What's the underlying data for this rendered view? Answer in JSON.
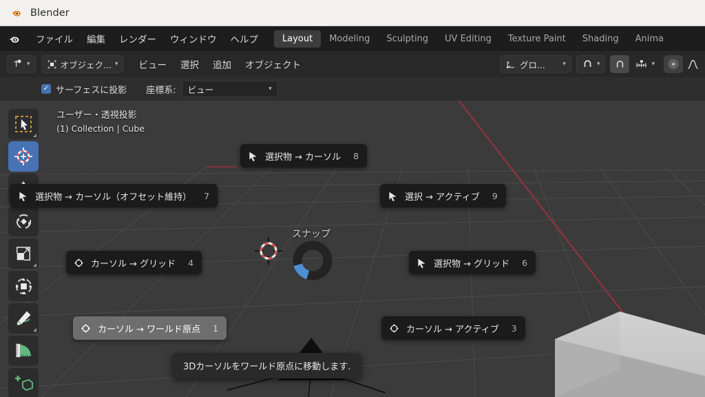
{
  "window": {
    "app_title": "Blender",
    "logo_icon": "blender-logo-icon"
  },
  "topbar": {
    "logo_icon": "blender-logo-icon",
    "menus": [
      "ファイル",
      "編集",
      "レンダー",
      "ウィンドウ",
      "ヘルプ"
    ],
    "tabs": [
      {
        "label": "Layout",
        "active": true
      },
      {
        "label": "Modeling",
        "active": false
      },
      {
        "label": "Sculpting",
        "active": false
      },
      {
        "label": "UV Editing",
        "active": false
      },
      {
        "label": "Texture Paint",
        "active": false
      },
      {
        "label": "Shading",
        "active": false
      },
      {
        "label": "Anima",
        "active": false
      }
    ]
  },
  "tool_header": {
    "editor_type_icon": "editor-type-icon",
    "mode_icon": "object-mode-icon",
    "mode_label": "オブジェク...",
    "menus": [
      "ビュー",
      "選択",
      "追加",
      "オブジェクト"
    ],
    "transform_orientation_icon": "orientation-icon",
    "transform_orientation_label": "グロ...",
    "snap_magnet_icon": "magnet-icon",
    "snap_target_icon": "snap-increment-icon",
    "proportional_icon": "proportional-edit-icon",
    "falloff_icon": "falloff-curve-icon"
  },
  "tool_settings": {
    "project_checkbox_label": "サーフェスに投影",
    "project_checked": true,
    "orientation_label": "座標系:",
    "orientation_value": "ビュー"
  },
  "viewport": {
    "view_name": "ユーザー・透視投影",
    "collection_info": "(1) Collection | Cube",
    "background_color": "#3b3b3b",
    "grid_color": "#4f4f4f",
    "x_axis_color": "#a6394b",
    "y_axis_color": "#7aa62a",
    "cube_color": "#c8c8c8",
    "cursor_icon": "3d-cursor-icon"
  },
  "left_toolbar": {
    "tools": [
      {
        "name": "tweak-select-box",
        "icon": "select-box-icon",
        "active": false,
        "has_submenu": true
      },
      {
        "name": "cursor",
        "icon": "3d-cursor-icon",
        "active": true,
        "has_submenu": false
      },
      {
        "name": "move",
        "icon": "move-icon",
        "active": false,
        "has_submenu": false
      },
      {
        "name": "rotate",
        "icon": "rotate-icon",
        "active": false,
        "has_submenu": false
      },
      {
        "name": "scale",
        "icon": "scale-icon",
        "active": false,
        "has_submenu": true
      },
      {
        "name": "transform",
        "icon": "transform-icon",
        "active": false,
        "has_submenu": false
      },
      {
        "name": "annotate",
        "icon": "annotate-pencil-icon",
        "active": false,
        "has_submenu": true
      },
      {
        "name": "measure",
        "icon": "measure-ruler-icon",
        "active": false,
        "has_submenu": false
      },
      {
        "name": "add-cube",
        "icon": "add-cube-icon",
        "active": false,
        "has_submenu": false
      }
    ]
  },
  "pie_menu": {
    "center_label": "スナップ",
    "items": [
      {
        "label": "選択物 → カーソル",
        "key": "8",
        "icon": "cursor-arrow-icon",
        "highlighted": false
      },
      {
        "label": "選択物 → カーソル（オフセット維持）",
        "key": "7",
        "icon": "cursor-arrow-icon",
        "highlighted": false
      },
      {
        "label": "選択 → アクティブ",
        "key": "9",
        "icon": "cursor-arrow-icon",
        "highlighted": false
      },
      {
        "label": "カーソル → グリッド",
        "key": "4",
        "icon": "3d-cursor-icon",
        "highlighted": false
      },
      {
        "label": "選択物 → グリッド",
        "key": "6",
        "icon": "cursor-arrow-icon",
        "highlighted": false
      },
      {
        "label": "カーソル → ワールド原点",
        "key": "1",
        "icon": "3d-cursor-icon",
        "highlighted": true
      },
      {
        "label": "カーソル → アクティブ",
        "key": "3",
        "icon": "3d-cursor-icon",
        "highlighted": false
      }
    ]
  },
  "tooltip": {
    "text": "3Dカーソルをワールド原点に移動します."
  }
}
